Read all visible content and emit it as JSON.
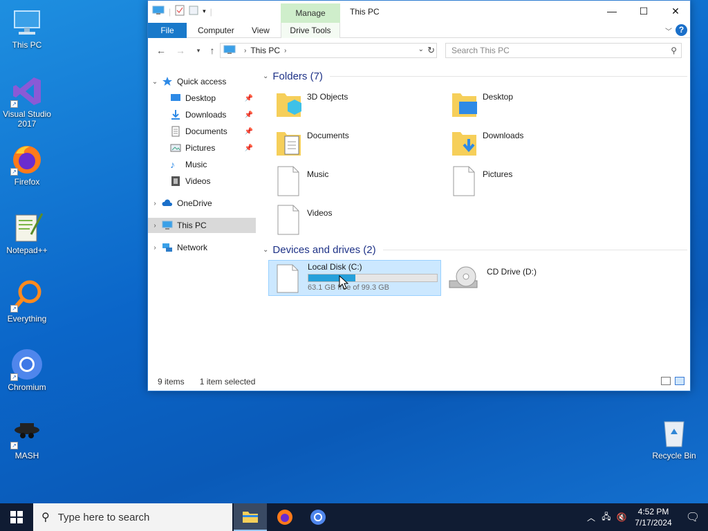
{
  "desktop": {
    "icons": [
      {
        "label": "This PC",
        "icon": "this-pc-icon"
      },
      {
        "label": "Visual Studio 2017",
        "icon": "visual-studio-icon"
      },
      {
        "label": "Firefox",
        "icon": "firefox-icon"
      },
      {
        "label": "Notepad++",
        "icon": "notepadpp-icon"
      },
      {
        "label": "Everything",
        "icon": "everything-icon"
      },
      {
        "label": "Chromium",
        "icon": "chromium-icon"
      },
      {
        "label": "MASH",
        "icon": "mash-icon"
      },
      {
        "label": "Recycle Bin",
        "icon": "recycle-bin-icon"
      }
    ]
  },
  "window": {
    "title": "This PC",
    "manage_tab": "Manage",
    "ribbon_tabs": [
      "File",
      "Computer",
      "View",
      "Drive Tools"
    ],
    "address": {
      "root": "This PC"
    },
    "search_placeholder": "Search This PC",
    "nav_pane": {
      "quick_access": "Quick access",
      "quick_items": [
        "Desktop",
        "Downloads",
        "Documents",
        "Pictures",
        "Music",
        "Videos"
      ],
      "onedrive": "OneDrive",
      "this_pc": "This PC",
      "network": "Network"
    },
    "folders_header": "Folders (7)",
    "folders": [
      "3D Objects",
      "Desktop",
      "Documents",
      "Downloads",
      "Music",
      "Pictures",
      "Videos"
    ],
    "drives_header": "Devices and drives (2)",
    "drives": [
      {
        "name": "Local Disk (C:)",
        "free_text": "63.1 GB free of 99.3 GB",
        "used_fraction": 0.365
      },
      {
        "name": "CD Drive (D:)"
      }
    ],
    "status": {
      "items": "9 items",
      "selected": "1 item selected"
    }
  },
  "taskbar": {
    "search_placeholder": "Type here to search",
    "time": "4:52 PM",
    "date": "7/17/2024"
  },
  "colors": {
    "accent": "#1979ca",
    "desktop": "#0b66c9",
    "selection": "#cce8ff",
    "drive_bar": "#26a0da"
  }
}
